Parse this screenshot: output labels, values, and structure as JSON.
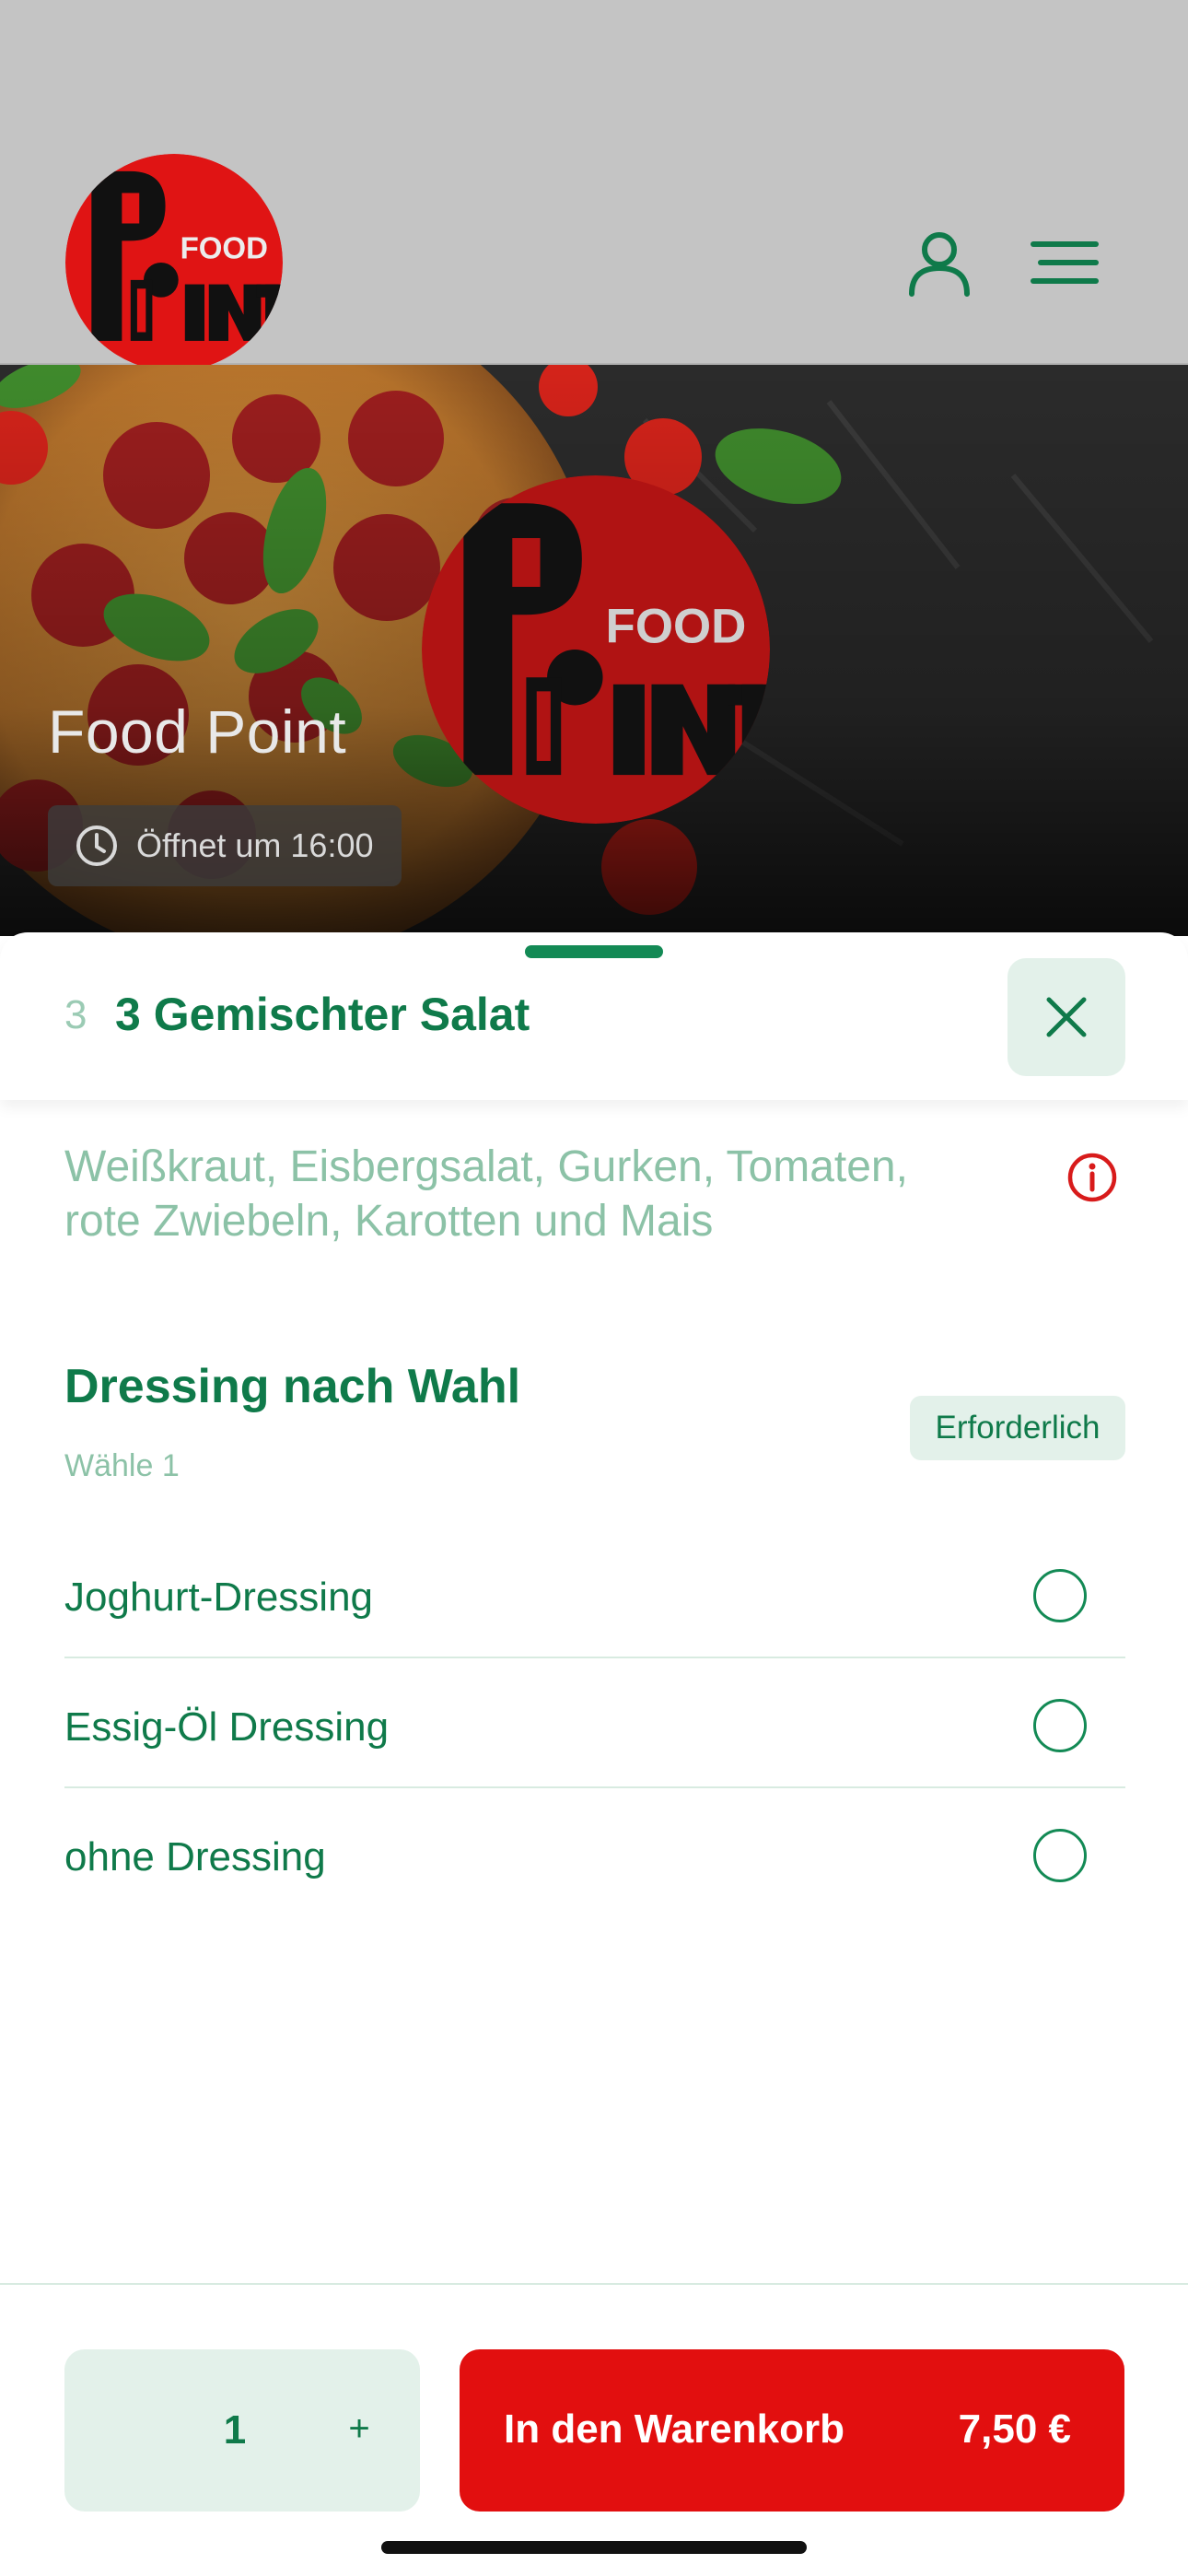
{
  "header": {
    "logo_small_text": "FOOD",
    "logo_big_text": "POINT",
    "user_icon": "user-icon",
    "menu_icon": "hamburger-menu-icon"
  },
  "hero": {
    "restaurant_name": "Food Point",
    "opening_hours": "Öffnet um 16:00",
    "clock_icon": "clock-icon"
  },
  "sheet": {
    "item_number": "3",
    "item_title": "3 Gemischter Salat",
    "close_icon": "close-icon",
    "description": "Weißkraut, Eisbergsalat, Gurken, Tomaten, rote Zwiebeln, Karotten und Mais",
    "info_icon": "info-icon"
  },
  "option_group": {
    "title": "Dressing nach Wahl",
    "subtitle": "Wähle 1",
    "badge": "Erforderlich",
    "options": [
      {
        "label": "Joghurt-Dressing",
        "selected": false
      },
      {
        "label": "Essig-Öl Dressing",
        "selected": false
      },
      {
        "label": "ohne Dressing",
        "selected": false
      }
    ]
  },
  "footer": {
    "quantity": "1",
    "plus_label": "+",
    "cart_label": "In den Warenkorb",
    "price": "7,50 €"
  },
  "colors": {
    "primary_green": "#0f7a4a",
    "light_green_bg": "#e3f1ea",
    "cart_red": "#e20f0f",
    "info_red": "#d81b1b"
  }
}
